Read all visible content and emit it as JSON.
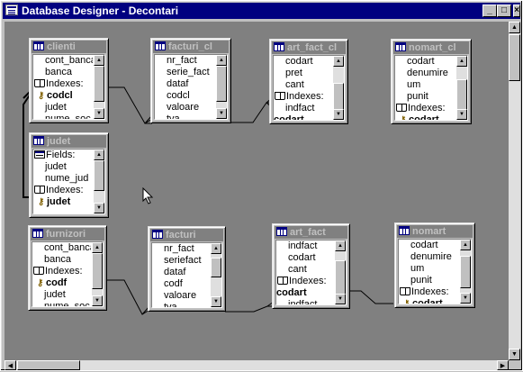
{
  "window": {
    "title": "Database Designer - Decontari"
  },
  "titlebar_buttons": {
    "minimize": "_",
    "maximize": "□",
    "close": "×"
  },
  "tables": [
    {
      "name": "clienti",
      "rows": [
        {
          "kind": "field",
          "text": "cont_banca"
        },
        {
          "kind": "field",
          "text": "banca"
        },
        {
          "kind": "section",
          "icon": "index-icon",
          "text": "Indexes:"
        },
        {
          "kind": "key",
          "text": "codcl"
        },
        {
          "kind": "field",
          "text": "judet"
        },
        {
          "kind": "field",
          "text": "nume_soc"
        }
      ]
    },
    {
      "name": "facturi_cl",
      "rows": [
        {
          "kind": "field",
          "text": "nr_fact"
        },
        {
          "kind": "field",
          "text": "serie_fact"
        },
        {
          "kind": "field",
          "text": "dataf"
        },
        {
          "kind": "field",
          "text": "codcl"
        },
        {
          "kind": "field",
          "text": "valoare"
        },
        {
          "kind": "field",
          "text": "tva"
        }
      ]
    },
    {
      "name": "art_fact_cl",
      "rows": [
        {
          "kind": "field",
          "text": "codart"
        },
        {
          "kind": "field",
          "text": "pret"
        },
        {
          "kind": "field",
          "text": "cant"
        },
        {
          "kind": "section",
          "icon": "index-icon",
          "text": "Indexes:"
        },
        {
          "kind": "field",
          "text": "indfact"
        },
        {
          "kind": "bold",
          "text": "codart"
        }
      ]
    },
    {
      "name": "nomart_cl",
      "rows": [
        {
          "kind": "field",
          "text": "codart"
        },
        {
          "kind": "field",
          "text": "denumire"
        },
        {
          "kind": "field",
          "text": "um"
        },
        {
          "kind": "field",
          "text": "punit"
        },
        {
          "kind": "section",
          "icon": "index-icon",
          "text": "Indexes:"
        },
        {
          "kind": "key",
          "text": "codart"
        }
      ]
    },
    {
      "name": "judet",
      "rows": [
        {
          "kind": "section",
          "icon": "fields-icon",
          "text": "Fields:"
        },
        {
          "kind": "field",
          "text": "judet"
        },
        {
          "kind": "field",
          "text": "nume_jud"
        },
        {
          "kind": "section",
          "icon": "index-icon",
          "text": "Indexes:"
        },
        {
          "kind": "key",
          "text": "judet"
        }
      ]
    },
    {
      "name": "furnizori",
      "rows": [
        {
          "kind": "field",
          "text": "cont_banca"
        },
        {
          "kind": "field",
          "text": "banca"
        },
        {
          "kind": "section",
          "icon": "index-icon",
          "text": "Indexes:"
        },
        {
          "kind": "key",
          "text": "codf"
        },
        {
          "kind": "field",
          "text": "judet"
        },
        {
          "kind": "field",
          "text": "nume_soc"
        }
      ]
    },
    {
      "name": "facturi",
      "rows": [
        {
          "kind": "field",
          "text": "nr_fact"
        },
        {
          "kind": "field",
          "text": "seriefact"
        },
        {
          "kind": "field",
          "text": "dataf"
        },
        {
          "kind": "field",
          "text": "codf"
        },
        {
          "kind": "field",
          "text": "valoare"
        },
        {
          "kind": "field",
          "text": "tva"
        }
      ]
    },
    {
      "name": "art_fact",
      "rows": [
        {
          "kind": "field",
          "text": "indfact"
        },
        {
          "kind": "field",
          "text": "codart"
        },
        {
          "kind": "field",
          "text": "cant"
        },
        {
          "kind": "section",
          "icon": "index-icon",
          "text": "Indexes:"
        },
        {
          "kind": "bold",
          "text": "codart"
        },
        {
          "kind": "field",
          "text": "indfact"
        }
      ]
    },
    {
      "name": "nomart",
      "rows": [
        {
          "kind": "field",
          "text": "codart"
        },
        {
          "kind": "field",
          "text": "denumire"
        },
        {
          "kind": "field",
          "text": "um"
        },
        {
          "kind": "field",
          "text": "punit"
        },
        {
          "kind": "section",
          "icon": "index-icon",
          "text": "Indexes:"
        },
        {
          "kind": "key",
          "text": "codart"
        }
      ]
    }
  ]
}
